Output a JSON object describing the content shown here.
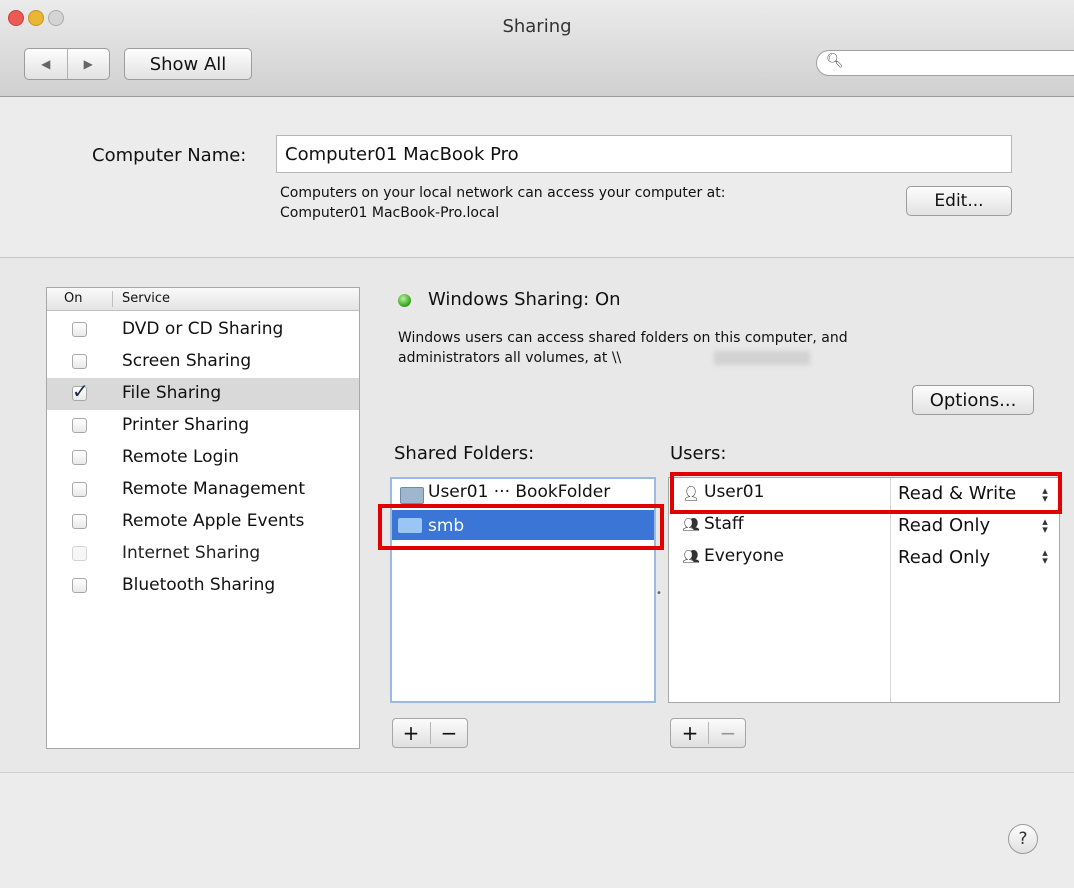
{
  "window": {
    "title": "Sharing",
    "traffic_lights": {
      "close": "#ec5a55",
      "minimize": "#e9b637",
      "zoom": "#c9c9c9"
    }
  },
  "toolbar": {
    "back_icon": "◀",
    "forward_icon": "▶",
    "show_all_label": "Show All",
    "search_placeholder": "",
    "search_icon": "magnifier-icon"
  },
  "computer": {
    "name_label": "Computer Name:",
    "name_value": "Computer01 MacBook Pro",
    "network_line1": "Computers on your local network can access your computer at:",
    "network_line2": "Computer01 MacBook-Pro.local",
    "edit_label": "Edit..."
  },
  "services": {
    "header_on": "On",
    "header_service": "Service",
    "items": [
      {
        "label": "DVD or CD Sharing",
        "checked": false
      },
      {
        "label": "Screen Sharing",
        "checked": false
      },
      {
        "label": "File Sharing",
        "checked": true,
        "selected": true
      },
      {
        "label": "Printer Sharing",
        "checked": false
      },
      {
        "label": "Remote Login",
        "checked": false
      },
      {
        "label": "Remote Management",
        "checked": false
      },
      {
        "label": "Remote Apple Events",
        "checked": false
      },
      {
        "label": "Internet Sharing",
        "checked": false,
        "disabled": true
      },
      {
        "label": "Bluetooth Sharing",
        "checked": false
      }
    ]
  },
  "status": {
    "title": "Windows Sharing: On",
    "description_line1": "Windows users can access shared folders on this computer, and",
    "description_line2": "administrators all volumes, at \\\\",
    "options_label": "Options..."
  },
  "shared_folders": {
    "label": "Shared Folders:",
    "items": [
      {
        "name": "User01 ··· BookFolder"
      },
      {
        "name": "smb",
        "selected": true
      }
    ],
    "add_label": "+",
    "remove_label": "−"
  },
  "users": {
    "label": "Users:",
    "items": [
      {
        "name": "User01",
        "permission": "Read & Write"
      },
      {
        "name": "Staff",
        "permission": "Read Only"
      },
      {
        "name": "Everyone",
        "permission": "Read Only"
      }
    ],
    "add_label": "+",
    "remove_label": "−"
  },
  "help_label": "?",
  "colors": {
    "highlight_box": "#e00000",
    "selection": "#3b76d7",
    "status_on": "#2f9e17"
  }
}
